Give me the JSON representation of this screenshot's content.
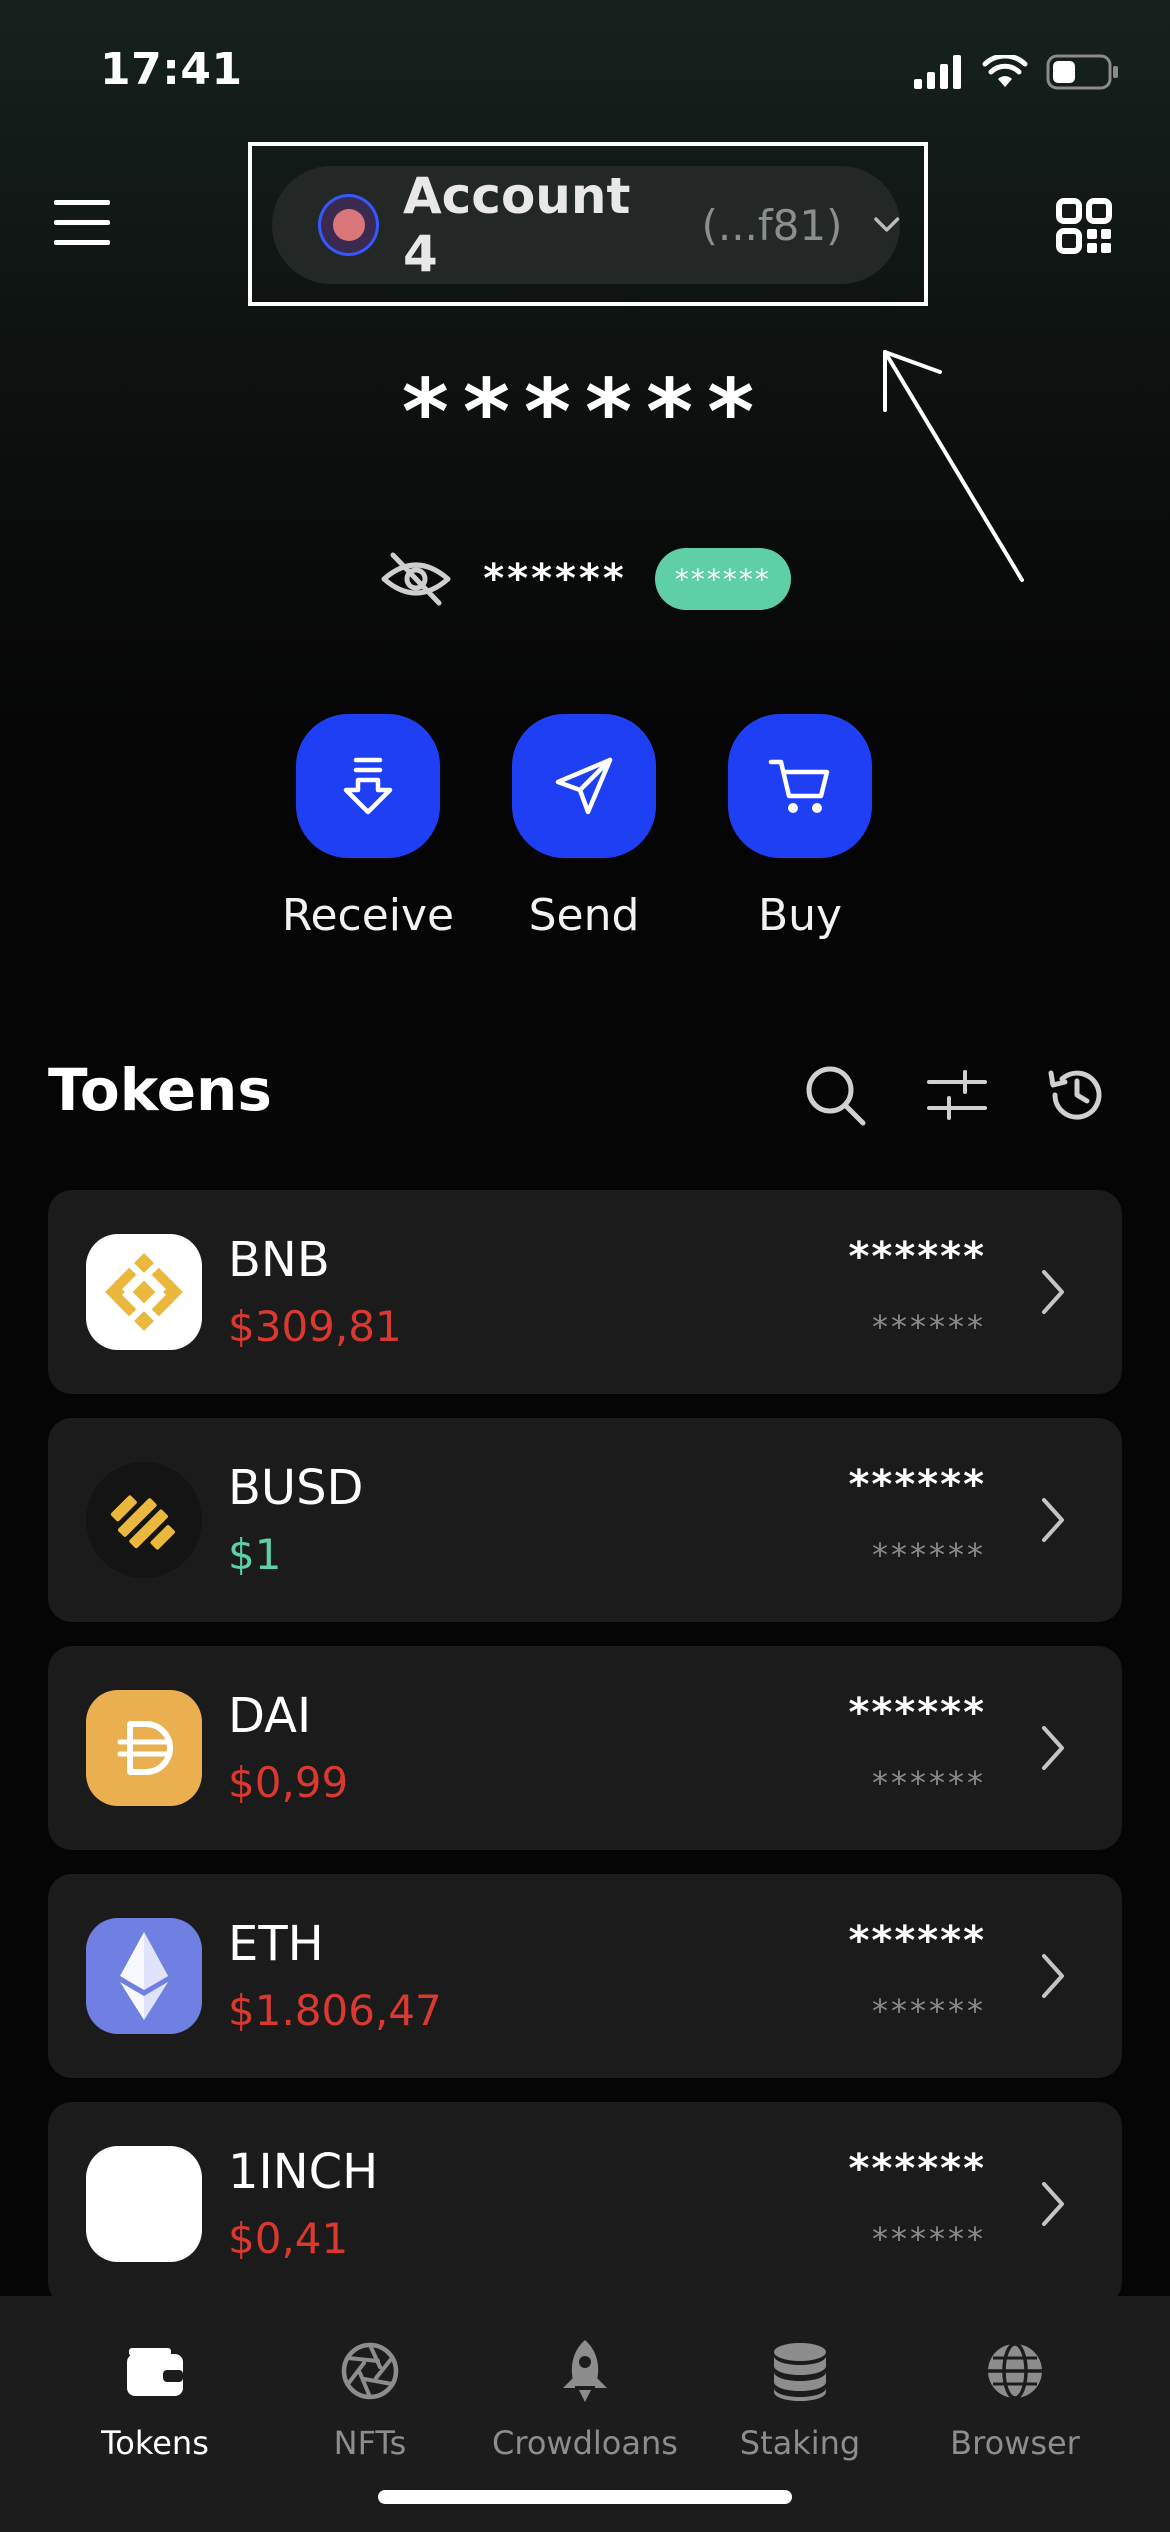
{
  "status_bar": {
    "time": "17:41"
  },
  "header": {
    "account_name": "Account 4",
    "account_address": "(...f81)"
  },
  "balance": {
    "total": "******",
    "change": "******",
    "change_percent": "******"
  },
  "actions": [
    {
      "label": "Receive",
      "icon": "receive-icon"
    },
    {
      "label": "Send",
      "icon": "send-icon"
    },
    {
      "label": "Buy",
      "icon": "cart-icon"
    }
  ],
  "tokens_section": {
    "title": "Tokens"
  },
  "tokens": [
    {
      "symbol": "BNB",
      "price": "$309,81",
      "price_color": "#d9392f",
      "balance": "******",
      "fiat": "******"
    },
    {
      "symbol": "BUSD",
      "price": "$1",
      "price_color": "#5fd0a6",
      "balance": "******",
      "fiat": "******"
    },
    {
      "symbol": "DAI",
      "price": "$0,99",
      "price_color": "#d9392f",
      "balance": "******",
      "fiat": "******"
    },
    {
      "symbol": "ETH",
      "price": "$1.806,47",
      "price_color": "#d9392f",
      "balance": "******",
      "fiat": "******"
    },
    {
      "symbol": "1INCH",
      "price": "$0,41",
      "price_color": "#d9392f",
      "balance": "******",
      "fiat": "******"
    }
  ],
  "tabbar": [
    {
      "label": "Tokens",
      "icon": "wallet-icon",
      "active": true
    },
    {
      "label": "NFTs",
      "icon": "aperture-icon",
      "active": false
    },
    {
      "label": "Crowdloans",
      "icon": "rocket-icon",
      "active": false
    },
    {
      "label": "Staking",
      "icon": "coins-stack-icon",
      "active": false
    },
    {
      "label": "Browser",
      "icon": "globe-icon",
      "active": false
    }
  ],
  "colors": {
    "accent": "#1f3ff5",
    "positive": "#5fd0a6",
    "negative": "#d9392f"
  }
}
